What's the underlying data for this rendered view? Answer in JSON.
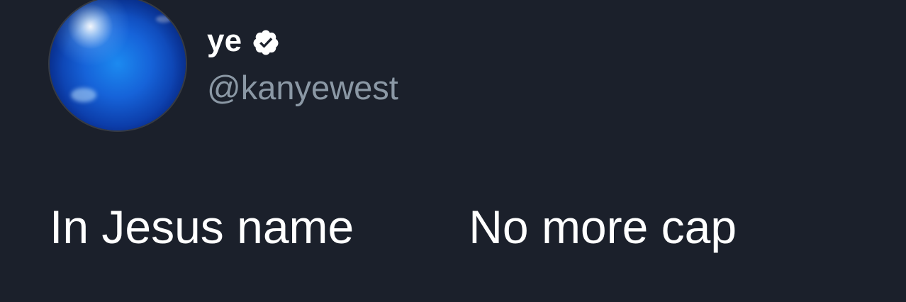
{
  "tweet": {
    "author": {
      "display_name": "ye",
      "handle": "@kanyewest",
      "verified": true,
      "avatar_icon": "blue-sphere-avatar-icon",
      "verified_icon": "verified-badge-icon"
    },
    "text_part_1": "In Jesus name",
    "text_part_2": "No more cap"
  },
  "colors": {
    "background": "#1b202b",
    "name": "#ffffff",
    "handle": "#8b98a5",
    "text": "#ffffff",
    "avatar_blue": "#1663d9"
  }
}
